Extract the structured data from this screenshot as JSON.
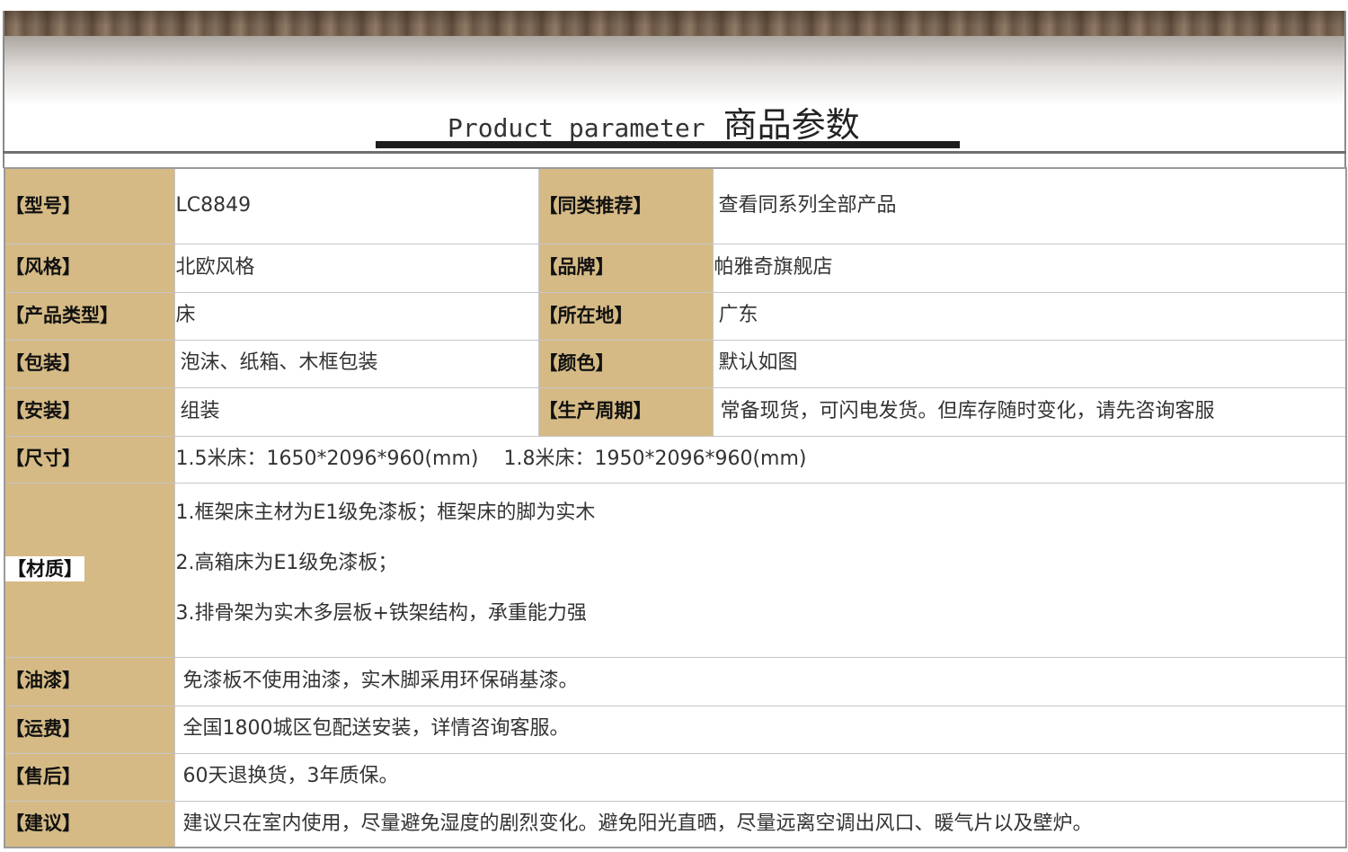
{
  "header": {
    "title_en": "Product parameter",
    "title_zh": "商品参数"
  },
  "params": [
    {
      "label": "【型号】",
      "value": "LC8849",
      "label2": "【同类推荐】",
      "value2": "查看同系列全部产品"
    },
    {
      "label": "【风格】",
      "value": "北欧风格",
      "label2": "【品牌】",
      "value2": "帕雅奇旗舰店"
    },
    {
      "label": "【产品类型】",
      "value": "床",
      "label2": "【所在地】",
      "value2": "广东"
    },
    {
      "label": "【包装】",
      "value": "泡沫、纸箱、木框包装",
      "label2": "【颜色】",
      "value2": "默认如图"
    },
    {
      "label": "【安装】",
      "value": "组装",
      "label2": "【生产周期】",
      "value2": "常备现货，可闪电发货。但库存随时变化，请先咨询客服"
    },
    {
      "label": "【尺寸】",
      "values": [
        "1.5米床：1650*2096*960(mm)",
        "1.8米床：1950*2096*960(mm)"
      ]
    },
    {
      "label": "【材质】",
      "lines": [
        "1.框架床主材为E1级免漆板；框架床的脚为实木",
        "2.高箱床为E1级免漆板；",
        "3.排骨架为实木多层板+铁架结构，承重能力强"
      ]
    },
    {
      "label": "【油漆】",
      "value": "免漆板不使用油漆，实木脚采用环保硝基漆。"
    },
    {
      "label": "【运费】",
      "value": "全国1800城区包配送安装，详情咨询客服。"
    },
    {
      "label": "【售后】",
      "value": "60天退换货，3年质保。"
    },
    {
      "label": "【建议】",
      "value": "建议只在室内使用，尽量避免湿度的剧烈变化。避免阳光直晒，尽量远离空调出风口、暖气片以及壁炉。"
    }
  ],
  "colors": {
    "label_bg": "#d5ba85",
    "title_bar": "#1e1e1e",
    "header_wood": "#6e5a48"
  }
}
